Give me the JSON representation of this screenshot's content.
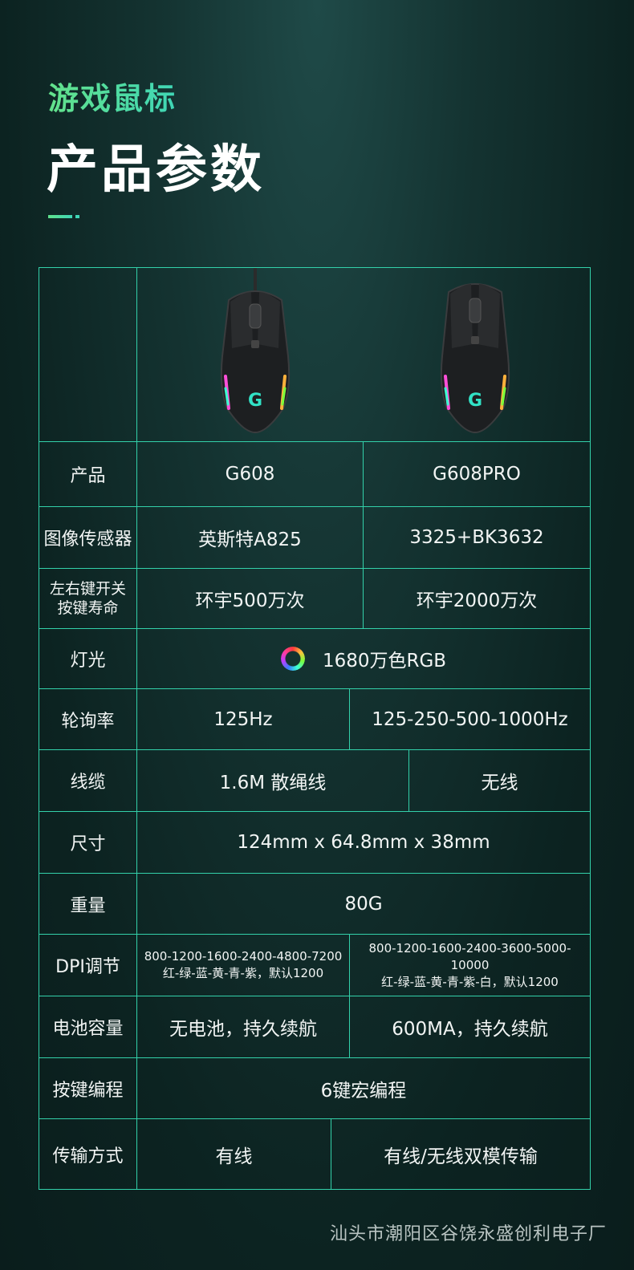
{
  "header": {
    "subtitle": "游戏鼠标",
    "title": "产品参数"
  },
  "table": {
    "product": {
      "label": "产品",
      "g608": "G608",
      "g608pro": "G608PRO"
    },
    "sensor": {
      "label": "图像传感器",
      "g608": "英斯特A825",
      "g608pro": "3325+BK3632"
    },
    "switch_life": {
      "label_line1": "左右键开关",
      "label_line2": "按键寿命",
      "g608": "环宇500万次",
      "g608pro": "环宇2000万次"
    },
    "lighting": {
      "label": "灯光",
      "value": "1680万色RGB"
    },
    "polling": {
      "label": "轮询率",
      "g608": "125Hz",
      "g608pro": "125-250-500-1000Hz"
    },
    "cable": {
      "label": "线缆",
      "g608": "1.6M 散绳线",
      "g608pro": "无线"
    },
    "size": {
      "label": "尺寸",
      "value": "124mm x 64.8mm x 38mm"
    },
    "weight": {
      "label": "重量",
      "value": "80G"
    },
    "dpi": {
      "label": "DPI调节",
      "g608_line1": "800-1200-1600-2400-4800-7200",
      "g608_line2": "红-绿-蓝-黄-青-紫，默认1200",
      "g608pro_line1": "800-1200-1600-2400-3600-5000-10000",
      "g608pro_line2": "红-绿-蓝-黄-青-紫-白，默认1200"
    },
    "battery": {
      "label": "电池容量",
      "g608": "无电池，持久续航",
      "g608pro": "600MA，持久续航"
    },
    "macro": {
      "label": "按键编程",
      "value": "6键宏编程"
    },
    "transfer": {
      "label": "传输方式",
      "g608": "有线",
      "g608pro": "有线/无线双模传输"
    }
  },
  "icons": [
    "mouse-wired-image",
    "mouse-wireless-image",
    "rgb-ring-icon",
    "mouse-logo-icon"
  ],
  "colors": {
    "accent": "#33d1aa",
    "title_gradient_start": "#63e28b",
    "title_gradient_end": "#3fd6b6",
    "background": "#143331"
  },
  "footer": {
    "company": "汕头市潮阳区谷饶永盛创利电子厂"
  }
}
